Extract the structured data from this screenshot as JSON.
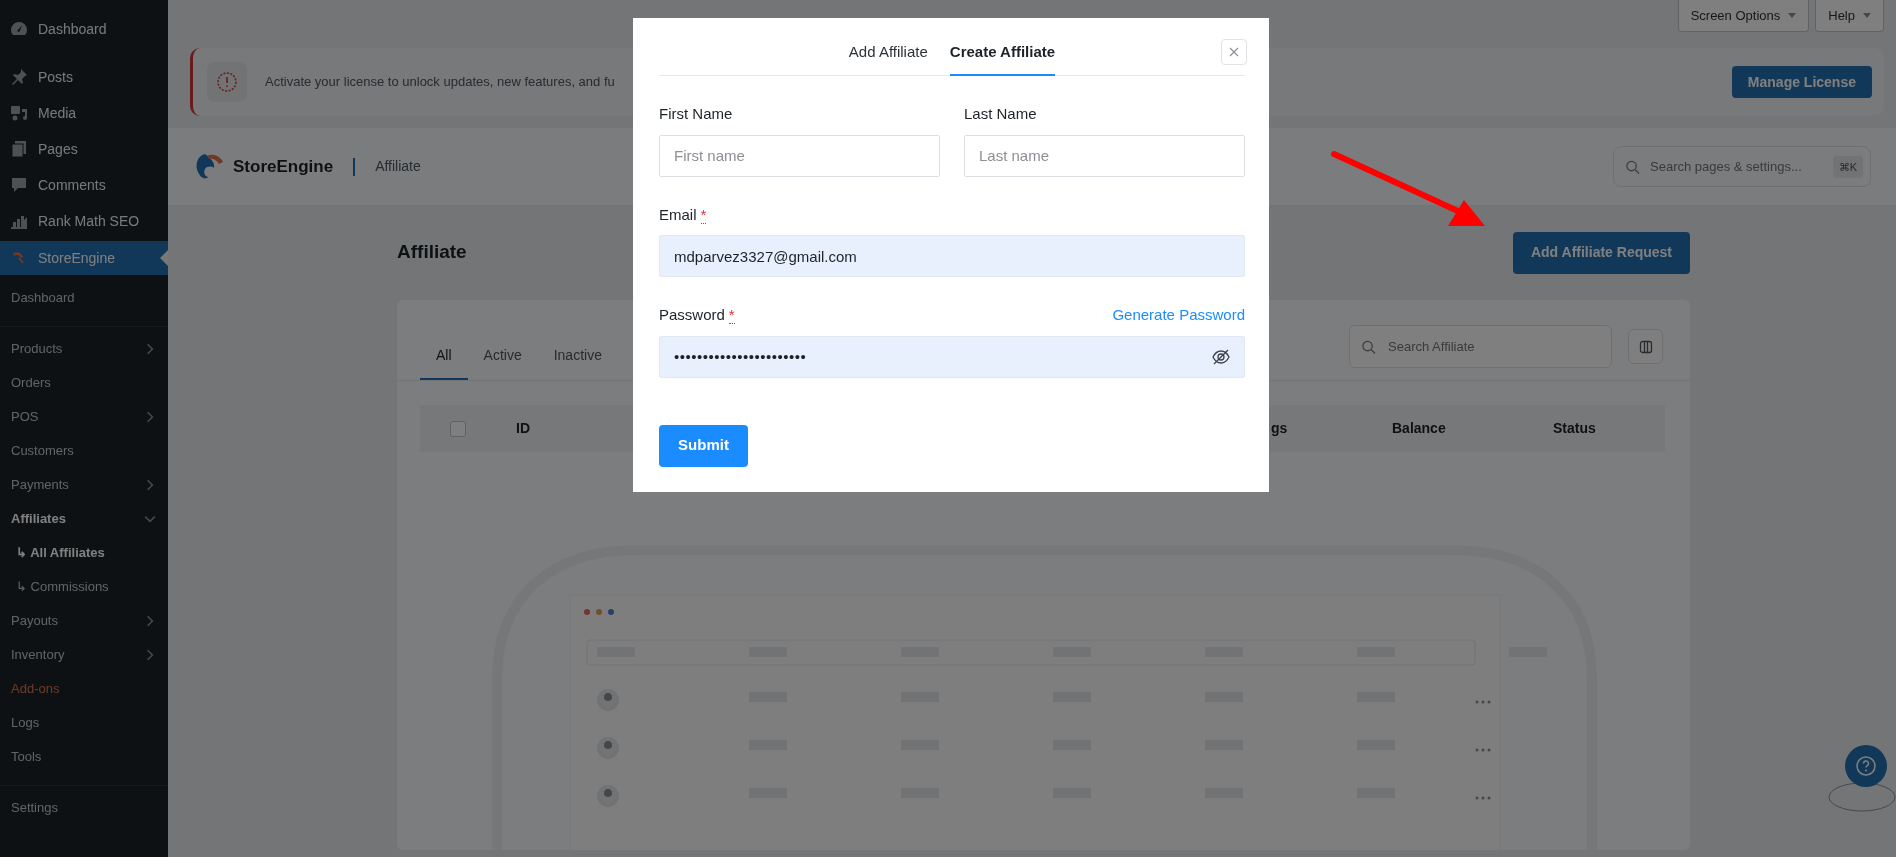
{
  "top_bar": {
    "buttons": [
      {
        "label": "Screen Options"
      },
      {
        "label": "Help"
      }
    ]
  },
  "sidebar": {
    "menu": [
      {
        "label": "Dashboard",
        "selected": false
      },
      {
        "label": "Posts",
        "selected": false
      },
      {
        "label": "Media",
        "selected": false
      },
      {
        "label": "Pages",
        "selected": false
      },
      {
        "label": "Comments",
        "selected": false
      },
      {
        "label": "Rank Math SEO",
        "selected": false
      },
      {
        "label": "StoreEngine",
        "selected": true
      }
    ],
    "submenu": [
      {
        "items": [
          {
            "label": "Dashboard",
            "selected": false,
            "has_children": false,
            "expanded": false,
            "highlighted": false
          }
        ]
      },
      {
        "items": [
          {
            "label": "Products",
            "selected": false,
            "has_children": true,
            "expanded": false,
            "highlighted": false
          },
          {
            "label": "Orders",
            "selected": false,
            "has_children": false,
            "expanded": false,
            "highlighted": false
          },
          {
            "label": "POS",
            "selected": false,
            "has_children": true,
            "expanded": false,
            "highlighted": false
          },
          {
            "label": "Customers",
            "selected": false,
            "has_children": false,
            "expanded": false,
            "highlighted": false
          },
          {
            "label": "Payments",
            "selected": false,
            "has_children": true,
            "expanded": false,
            "highlighted": false
          },
          {
            "label": "Affiliates",
            "selected": true,
            "has_children": true,
            "expanded": true,
            "highlighted": false,
            "children": [
              {
                "marker": "↳",
                "label": "All Affiliates",
                "selected": true
              },
              {
                "marker": "↳",
                "label": "Commissions",
                "selected": false
              }
            ]
          },
          {
            "label": "Payouts",
            "selected": false,
            "has_children": true,
            "expanded": false,
            "highlighted": false
          },
          {
            "label": "Inventory",
            "selected": false,
            "has_children": true,
            "expanded": false,
            "highlighted": false
          },
          {
            "label": "Add-ons",
            "selected": false,
            "has_children": false,
            "expanded": false,
            "highlighted": true
          },
          {
            "label": "Logs",
            "selected": false,
            "has_children": false,
            "expanded": false,
            "highlighted": false
          },
          {
            "label": "Tools",
            "selected": false,
            "has_children": false,
            "expanded": false,
            "highlighted": false
          }
        ]
      },
      {
        "items": [
          {
            "label": "Settings",
            "selected": false,
            "has_children": false,
            "expanded": false,
            "highlighted": false
          }
        ]
      }
    ]
  },
  "license_banner": {
    "message": "Activate your license to unlock updates, new features, and fu",
    "button": "Manage License"
  },
  "header": {
    "brand": "StoreEngine",
    "section": "Affiliate",
    "search": {
      "placeholder": "Search pages & settings...",
      "shortcut": "⌘K"
    }
  },
  "page": {
    "title": "Affiliate",
    "primary_button": "Add Affiliate Request",
    "tabs": [
      {
        "label": "All",
        "selected": true
      },
      {
        "label": "Active",
        "selected": false
      },
      {
        "label": "Inactive",
        "selected": false
      }
    ],
    "search": {
      "placeholder": "Search Affiliate"
    },
    "table": {
      "select_all_checked": false,
      "columns": [
        "ID",
        "gs",
        "Balance",
        "Status"
      ]
    }
  },
  "modal": {
    "tabs": [
      {
        "label": "Add Affiliate",
        "selected": false
      },
      {
        "label": "Create Affiliate",
        "selected": true
      }
    ],
    "fields": [
      {
        "kind": "half",
        "label": "First Name",
        "placeholder": "First name",
        "autofilled": false
      },
      {
        "kind": "half",
        "label": "Last Name",
        "placeholder": "Last name",
        "autofilled": false
      },
      {
        "kind": "full",
        "label": "Email",
        "required_mark": "*",
        "value": "mdparvez3327@gmail.com",
        "autofilled": true
      },
      {
        "kind": "password",
        "label": "Password",
        "required_mark": "*",
        "action": "Generate Password",
        "value": "•••••••••••••••••••••••",
        "autofilled": true
      }
    ],
    "submit": "Submit"
  }
}
